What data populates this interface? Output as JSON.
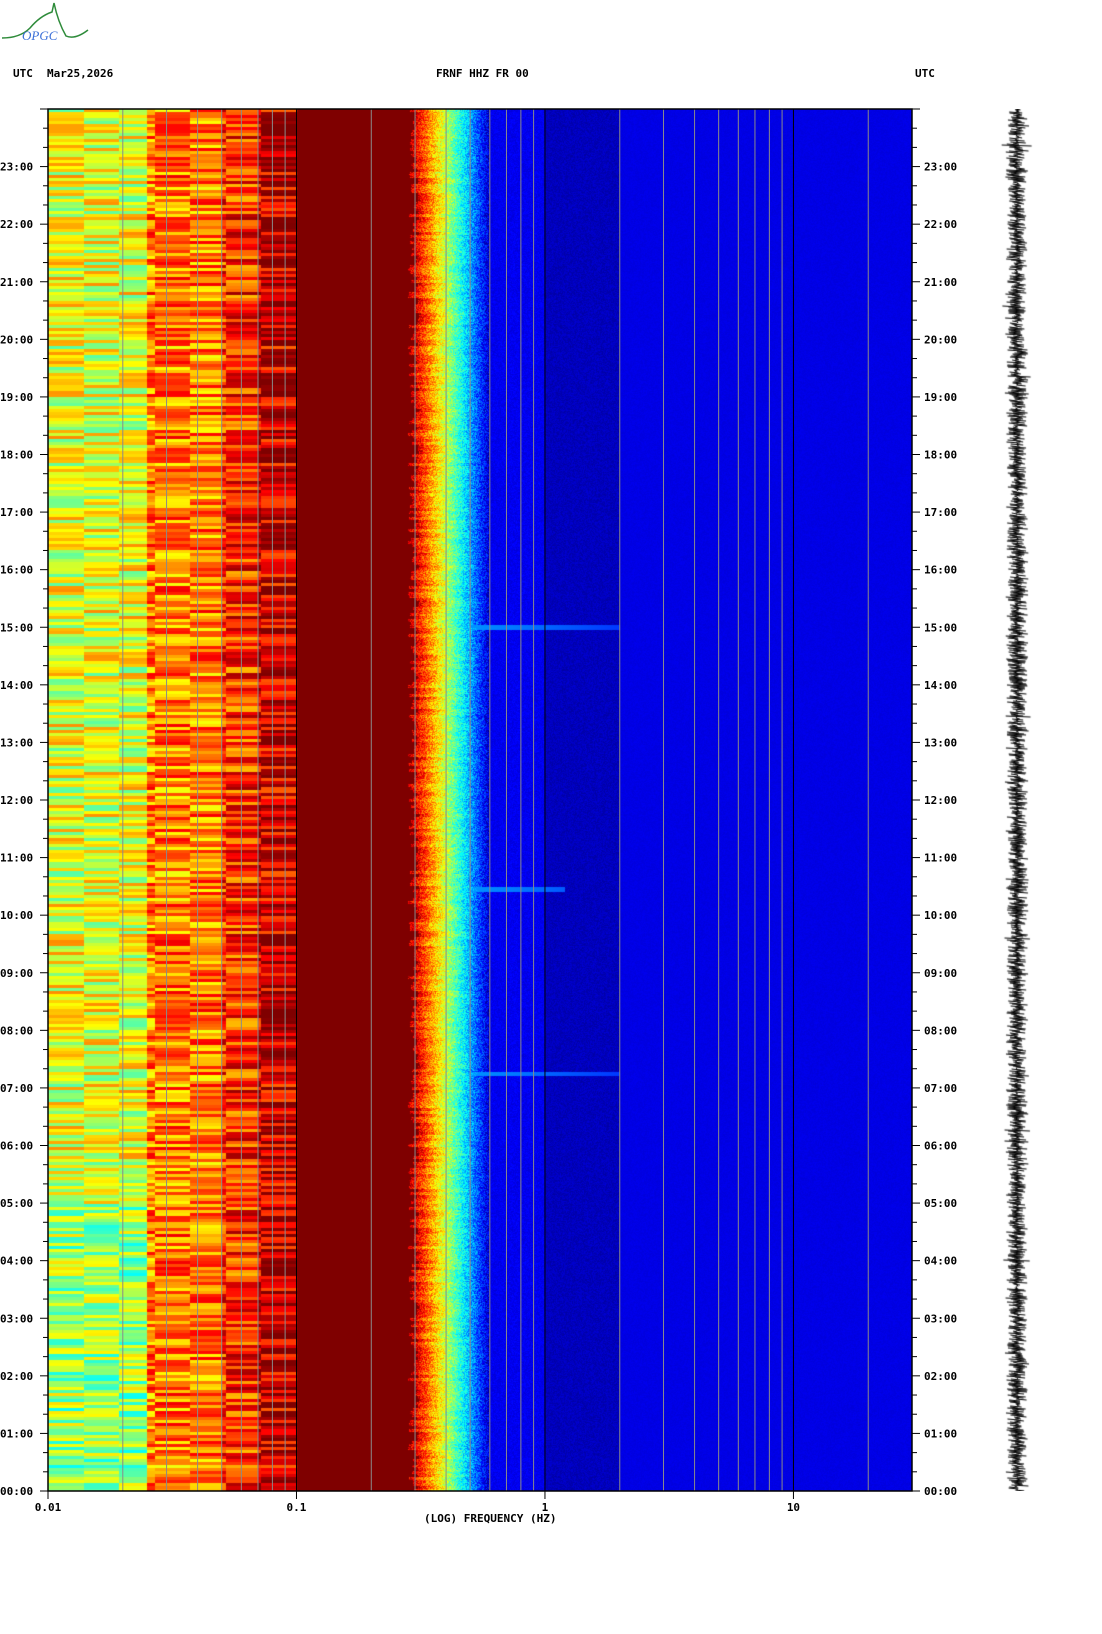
{
  "header": {
    "left_tz": "UTC",
    "date": "Mar25,2026",
    "station": "FRNF HHZ FR 00",
    "right_tz": "UTC",
    "logo_text": "OPGC"
  },
  "chart_data": {
    "type": "heatmap",
    "title": "FRNF HHZ FR 00",
    "xlabel": "(LOG) FREQUENCY (HZ)",
    "ylabel": "UTC",
    "xscale": "log",
    "xlim": [
      0.01,
      30
    ],
    "ylim_hours": [
      0,
      24
    ],
    "x_ticks": [
      {
        "value": 0.01,
        "label": "0.01"
      },
      {
        "value": 0.1,
        "label": "0.1"
      },
      {
        "value": 1,
        "label": "1"
      },
      {
        "value": 10,
        "label": "10"
      }
    ],
    "y_ticks": [
      "00:00",
      "01:00",
      "02:00",
      "03:00",
      "04:00",
      "05:00",
      "06:00",
      "07:00",
      "08:00",
      "09:00",
      "10:00",
      "11:00",
      "12:00",
      "13:00",
      "14:00",
      "15:00",
      "16:00",
      "17:00",
      "18:00",
      "19:00",
      "20:00",
      "21:00",
      "22:00",
      "23:00"
    ],
    "colormap": "jet",
    "bands": [
      {
        "f_from": 0.01,
        "f_to": 0.025,
        "level": 0.6
      },
      {
        "f_from": 0.025,
        "f_to": 0.05,
        "level": 0.75
      },
      {
        "f_from": 0.05,
        "f_to": 0.07,
        "level": 0.83
      },
      {
        "f_from": 0.07,
        "f_to": 0.1,
        "level": 0.92
      },
      {
        "f_from": 0.1,
        "f_to": 0.3,
        "level": 1.0
      },
      {
        "f_from": 0.3,
        "f_to": 0.4,
        "level": 0.75
      },
      {
        "f_from": 0.4,
        "f_to": 0.6,
        "level": 0.3
      },
      {
        "f_from": 0.6,
        "f_to": 2,
        "level": 0.05
      },
      {
        "f_from": 2,
        "f_to": 30,
        "level": 0.1
      }
    ],
    "events": [
      {
        "hour": 10.45,
        "f_to": 1.2
      },
      {
        "hour": 15.0,
        "f_to": 2
      },
      {
        "hour": 7.25,
        "f_to": 2
      }
    ]
  }
}
